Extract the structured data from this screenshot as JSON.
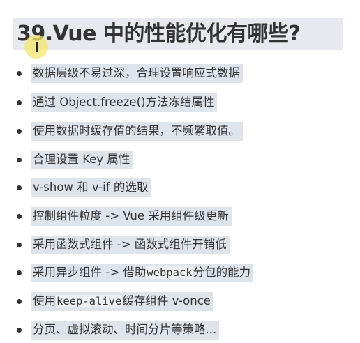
{
  "title": "39.Vue 中的性能优化有哪些?",
  "items": [
    {
      "text": "数据层级不易过深，合理设置响应式数据"
    },
    {
      "text": "通过 Object.freeze()方法冻结属性"
    },
    {
      "text": "使用数据时缓存值的结果，不频繁取值。"
    },
    {
      "text": "合理设置 Key 属性"
    },
    {
      "text": "v-show 和 v-if 的选取"
    },
    {
      "text": "控制组件粒度 -> Vue 采用组件级更新"
    },
    {
      "text": "采用函数式组件 -> 函数式组件开销低"
    },
    {
      "pre": "采用异步组件 -> 借助",
      "code": "webpack",
      "post": "分包的能力"
    },
    {
      "pre": "使用",
      "code": "keep-alive",
      "post": "缓存组件 v-once"
    },
    {
      "text": "分页、虚拟滚动、时间分片等策略..."
    }
  ]
}
